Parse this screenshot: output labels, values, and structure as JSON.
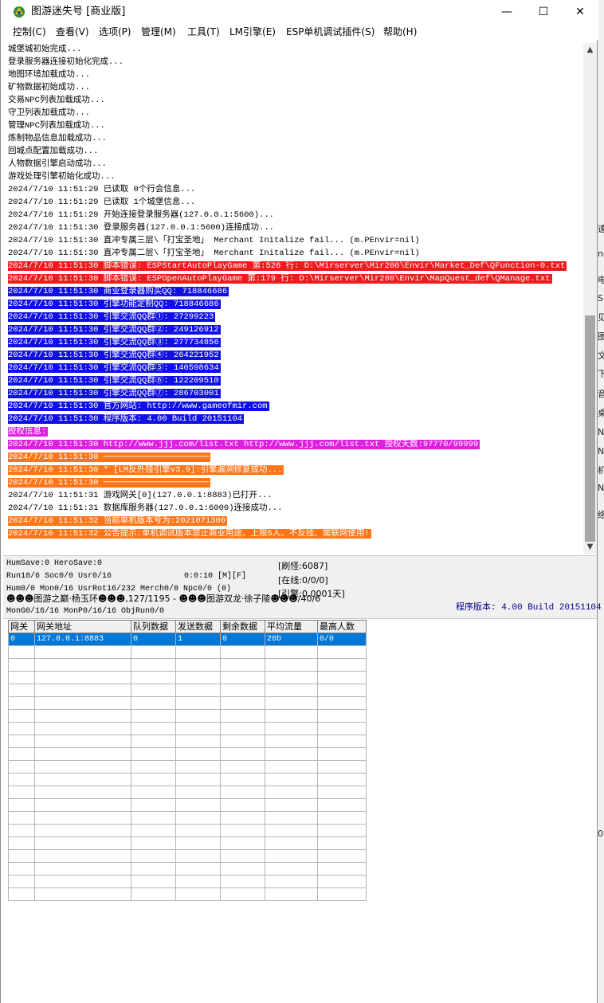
{
  "window": {
    "title": "图游迷失号 [商业版]",
    "minimize_glyph": "—",
    "maximize_glyph": "☐",
    "close_glyph": "✕"
  },
  "menu": [
    "控制(C)",
    "查看(V)",
    "选项(P)",
    "管理(M)",
    "工具(T)",
    "LM引擎(E)",
    "ESP单机调试插件(S)",
    "帮助(H)"
  ],
  "log": [
    {
      "text": "城堡城初始完成...",
      "hl": ""
    },
    {
      "text": "登录服务器连接初始化完成...",
      "hl": ""
    },
    {
      "text": "地图环境加载成功...",
      "hl": ""
    },
    {
      "text": "矿物数据初始成功...",
      "hl": ""
    },
    {
      "text": "交易NPC列表加载成功...",
      "hl": ""
    },
    {
      "text": "守卫列表加载成功...",
      "hl": ""
    },
    {
      "text": "管理NPC列表加载成功...",
      "hl": ""
    },
    {
      "text": "炼制物品信息加载成功...",
      "hl": ""
    },
    {
      "text": "回城点配置加载成功...",
      "hl": ""
    },
    {
      "text": "人物数据引擎启动成功...",
      "hl": ""
    },
    {
      "text": "游戏处理引擎初始化成功...",
      "hl": ""
    },
    {
      "text": "2024/7/10 11:51:29 已读取 0个行会信息...",
      "hl": ""
    },
    {
      "text": "2024/7/10 11:51:29 已读取 1个城堡信息...",
      "hl": ""
    },
    {
      "text": "2024/7/10 11:51:29 开始连接登录服务器(127.0.0.1:5600)...",
      "hl": ""
    },
    {
      "text": "2024/7/10 11:51:30 登录服务器(127.0.0.1:5600)连接成功...",
      "hl": ""
    },
    {
      "text": "2024/7/10 11:51:30 直冲专属三层\\「打宝圣地」 Merchant Initalize fail... (m.PEnvir=nil)",
      "hl": ""
    },
    {
      "text": "2024/7/10 11:51:30 直冲专属二层\\「打宝圣地」 Merchant Initalize fail... (m.PEnvir=nil)",
      "hl": ""
    },
    {
      "text": "2024/7/10 11:51:30 脚本错误: ESPStartAutoPlayGame 第:526 行: D:\\Mirserver\\Mir200\\Envir\\Market_Def\\QFunction-0.txt",
      "hl": "red"
    },
    {
      "text": "2024/7/10 11:51:30 脚本错误: ESPOpenAutoPlayGame 第:179 行: D:\\Mirserver\\Mir200\\Envir\\MapQuest_def\\QManage.txt",
      "hl": "red"
    },
    {
      "text": "2024/7/10 11:51:30 商业登录器购买QQ: 718846686",
      "hl": "blue"
    },
    {
      "text": "2024/7/10 11:51:30 引擎功能定制QQ: 718846686",
      "hl": "blue"
    },
    {
      "text": "2024/7/10 11:51:30 引擎交流QQ群①: 27299223",
      "hl": "blue"
    },
    {
      "text": "2024/7/10 11:51:30 引擎交流QQ群②: 249126912",
      "hl": "blue"
    },
    {
      "text": "2024/7/10 11:51:30 引擎交流QQ群③: 277734856",
      "hl": "blue"
    },
    {
      "text": "2024/7/10 11:51:30 引擎交流QQ群④: 264221952",
      "hl": "blue"
    },
    {
      "text": "2024/7/10 11:51:30 引擎交流QQ群⑤: 140598634",
      "hl": "blue"
    },
    {
      "text": "2024/7/10 11:51:30 引擎交流QQ群⑥: 122209510",
      "hl": "blue"
    },
    {
      "text": "2024/7/10 11:51:30 引擎交流QQ群⑦: 286703001",
      "hl": "blue"
    },
    {
      "text": "2024/7/10 11:51:30 官方网站: http://www.gameofmir.com",
      "hl": "blue"
    },
    {
      "text": "2024/7/10 11:51:30 程序版本: 4.00 Build 20151104",
      "hl": "blue"
    },
    {
      "text": "授权信息:",
      "hl": "magenta"
    },
    {
      "text": "2024/7/10 11:51:30 http://www.jjj.com/list.txt http://www.jjj.com/list.txt 授权天数:97770/99999",
      "hl": "magenta"
    },
    {
      "text": "2024/7/10 11:51:30 ─────────────────────",
      "hl": "orange"
    },
    {
      "text": "2024/7/10 11:51:30 * [LM反外挂引擎v3.9]:引擎漏洞修复成功...  ",
      "hl": "orange"
    },
    {
      "text": "2024/7/10 11:51:30 ─────────────────────",
      "hl": "orange"
    },
    {
      "text": "2024/7/10 11:51:31 游戏网关[0](127.0.0.1:8883)已打开...",
      "hl": ""
    },
    {
      "text": "2024/7/10 11:51:31 数据库服务器(127.0.0.1:6000)连接成功...",
      "hl": ""
    },
    {
      "text": "2024/7/10 11:51:32 当前单机版本号为:2021071300",
      "hl": "orange"
    },
    {
      "text": "2024/7/10 11:51:32 公告提示:单机调试版本禁止商业用途、上限5人、不反挂、需联网使用!",
      "hl": "orange"
    }
  ],
  "scrollbar": {
    "up": "▲",
    "down": "▼"
  },
  "status": {
    "hum_save": "HumSave:0 HeroSave:0",
    "run": "Run18/6 Soc0/0 Usr0/16",
    "timer": "0:0:10 [M][F]",
    "hum": "Hum0/0 Mon0/16 UsrRot16/232 Merch0/0 Npc0/0 (0)",
    "castle": "☻☻☻图游之巅·杨玉环☻☻☻,127/1195 - ☻☻☻图游双龙·徐子陵☻☻☻/40/6",
    "mon": "MonG0/16/16 MonP0/16/16 ObjRun0/0",
    "refresh": "[刷怪:6087]",
    "online": "[在线:0/0/0]",
    "engine": "[引擎:0.0001天]",
    "version": "程序版本: 4.00 Build 20151104"
  },
  "grid": {
    "columns": [
      "网关",
      "网关地址",
      "队列数据",
      "发送数据",
      "剩余数据",
      "平均流量",
      "最高人数"
    ],
    "rows": [
      [
        "0",
        "127.0.0.1:8883",
        "0",
        "1",
        "0",
        "20b",
        "0/0"
      ]
    ]
  },
  "desktop_glyphs": [
    "速",
    "ne",
    "电",
    "SD",
    "见",
    "图",
    "文",
    "下",
    "音",
    "桌",
    "NV",
    "NV",
    "机",
    "NV",
    "络",
    "0"
  ]
}
